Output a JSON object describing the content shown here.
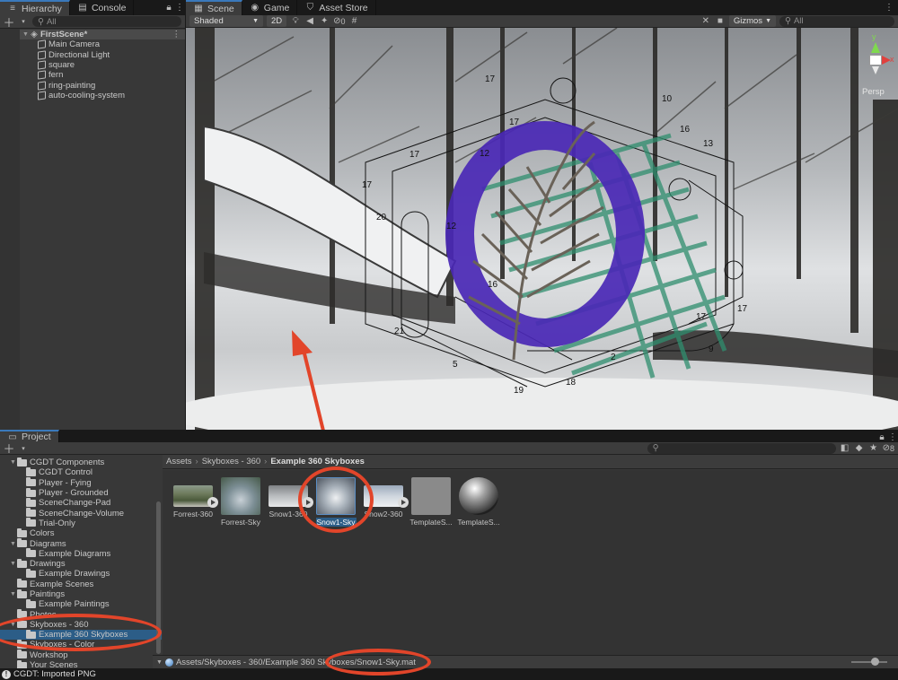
{
  "hierarchy_tabs": {
    "hierarchy": "Hierarchy",
    "console": "Console"
  },
  "hierarchy": {
    "search_placeholder": "All",
    "scene": "FirstScene*",
    "objects": [
      "Main Camera",
      "Directional Light",
      "square",
      "fern",
      "ring-painting",
      "auto-cooling-system"
    ]
  },
  "scene_tabs": {
    "scene": "Scene",
    "game": "Game",
    "asset_store": "Asset Store"
  },
  "scene_toolbar": {
    "shading": "Shaded",
    "mode_2d": "2D",
    "effects_count": "0",
    "gizmos": "Gizmos",
    "search_placeholder": "All"
  },
  "gizmo": {
    "y": "y",
    "x": "x",
    "projection": "Persp"
  },
  "scene_labels": [
    "17",
    "17",
    "12",
    "10",
    "16",
    "13",
    "17",
    "17",
    "20",
    "12",
    "21",
    "5",
    "19",
    "18",
    "2",
    "9",
    "17",
    "17",
    "16"
  ],
  "project": {
    "tab": "Project",
    "tree": [
      {
        "label": "CGDT Components",
        "level": 1,
        "open": true
      },
      {
        "label": "CGDT Control",
        "level": 2
      },
      {
        "label": "Player - Fying",
        "level": 2
      },
      {
        "label": "Player - Grounded",
        "level": 2
      },
      {
        "label": "SceneChange-Pad",
        "level": 2
      },
      {
        "label": "SceneChange-Volume",
        "level": 2
      },
      {
        "label": "Trial-Only",
        "level": 2
      },
      {
        "label": "Colors",
        "level": 1
      },
      {
        "label": "Diagrams",
        "level": 1,
        "open": true
      },
      {
        "label": "Example Diagrams",
        "level": 2
      },
      {
        "label": "Drawings",
        "level": 1,
        "open": true
      },
      {
        "label": "Example Drawings",
        "level": 2
      },
      {
        "label": "Example Scenes",
        "level": 1
      },
      {
        "label": "Paintings",
        "level": 1,
        "open": true
      },
      {
        "label": "Example Paintings",
        "level": 2
      },
      {
        "label": "Photos",
        "level": 1
      },
      {
        "label": "Skyboxes - 360",
        "level": 1,
        "open": true
      },
      {
        "label": "Example 360 Skyboxes",
        "level": 2,
        "selected": true
      },
      {
        "label": "Skyboxes - Color",
        "level": 1
      },
      {
        "label": "Workshop",
        "level": 1
      },
      {
        "label": "Your Scenes",
        "level": 1
      }
    ],
    "breadcrumb": [
      "Assets",
      "Skyboxes - 360",
      "Example 360 Skyboxes"
    ],
    "assets": [
      {
        "label": "Forrest-360",
        "thumb": "forest"
      },
      {
        "label": "Forrest-Sky",
        "thumb": "sky"
      },
      {
        "label": "Snow1-360",
        "thumb": "snow"
      },
      {
        "label": "Snow1-Sky",
        "thumb": "snowsky",
        "selected": true
      },
      {
        "label": "Snow2-360",
        "thumb": "snow2"
      },
      {
        "label": "TemplateS...",
        "thumb": "gray"
      },
      {
        "label": "TemplateS...",
        "thumb": "sphere"
      }
    ],
    "path": "Assets/Skyboxes - 360/Example 360 Skyboxes/Snow1-Sky.mat",
    "badge_count": "8"
  },
  "status": "CGDT: Imported PNG",
  "colors": {
    "accent": "#3a79bb",
    "annotation": "#e2452a",
    "selection": "#2c5d87"
  }
}
